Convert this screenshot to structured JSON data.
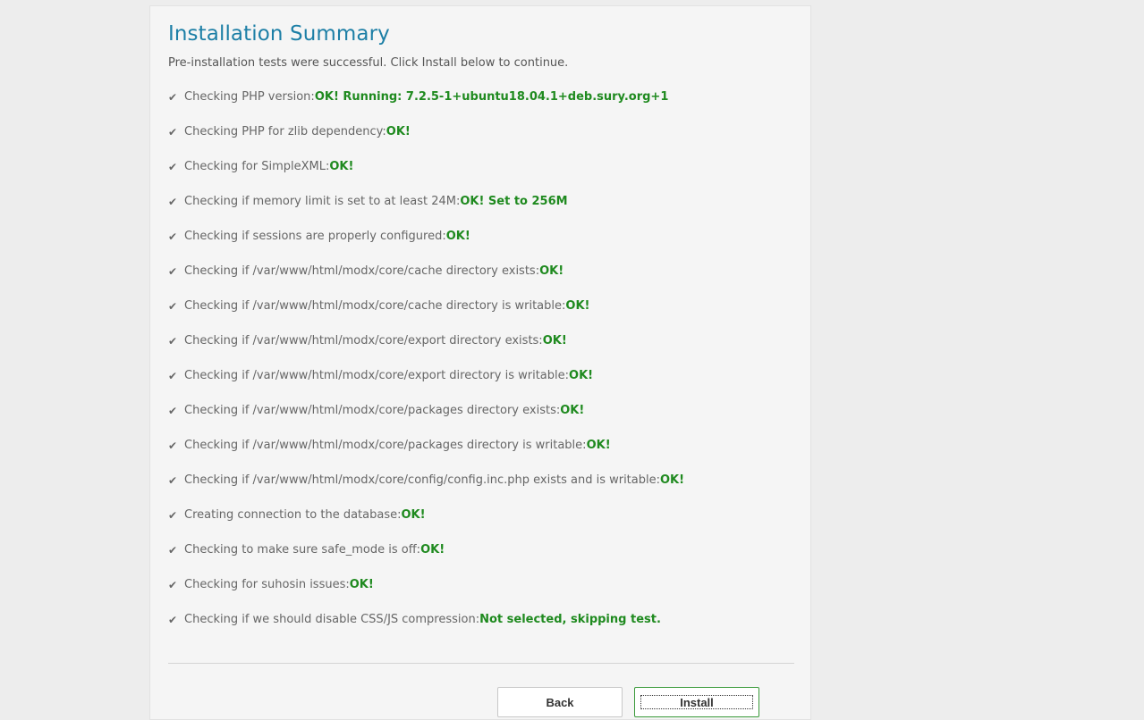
{
  "page": {
    "title": "Installation Summary",
    "subtitle": "Pre-installation tests were successful. Click Install below to continue."
  },
  "checks": [
    {
      "label": "Checking PHP version: ",
      "result": "OK! Running: 7.2.5-1+ubuntu18.04.1+deb.sury.org+1"
    },
    {
      "label": "Checking PHP for zlib dependency: ",
      "result": "OK!"
    },
    {
      "label": "Checking for SimpleXML: ",
      "result": "OK!"
    },
    {
      "label": "Checking if memory limit is set to at least 24M: ",
      "result": "OK! Set to 256M"
    },
    {
      "label": "Checking if sessions are properly configured: ",
      "result": "OK!"
    },
    {
      "label": "Checking if /var/www/html/modx/core/cache directory exists: ",
      "result": "OK!"
    },
    {
      "label": "Checking if /var/www/html/modx/core/cache directory is writable: ",
      "result": "OK!"
    },
    {
      "label": "Checking if /var/www/html/modx/core/export directory exists: ",
      "result": "OK!"
    },
    {
      "label": "Checking if /var/www/html/modx/core/export directory is writable: ",
      "result": "OK!"
    },
    {
      "label": "Checking if /var/www/html/modx/core/packages directory exists: ",
      "result": "OK!"
    },
    {
      "label": "Checking if /var/www/html/modx/core/packages directory is writable: ",
      "result": "OK!"
    },
    {
      "label": "Checking if /var/www/html/modx/core/config/config.inc.php exists and is writable: ",
      "result": "OK!"
    },
    {
      "label": "Creating connection to the database: ",
      "result": "OK!"
    },
    {
      "label": "Checking to make sure safe_mode is off: ",
      "result": "OK!"
    },
    {
      "label": "Checking for suhosin issues:",
      "result": "OK!"
    },
    {
      "label": "Checking if we should disable CSS/JS compression: ",
      "result": "Not selected, skipping test."
    }
  ],
  "icons": {
    "check": "check-icon"
  },
  "colors": {
    "title": "#1d7fa6",
    "ok": "#1f8a1f",
    "install_border": "#3a9a3a"
  },
  "buttons": {
    "back_label": "Back",
    "install_label": "Install"
  }
}
